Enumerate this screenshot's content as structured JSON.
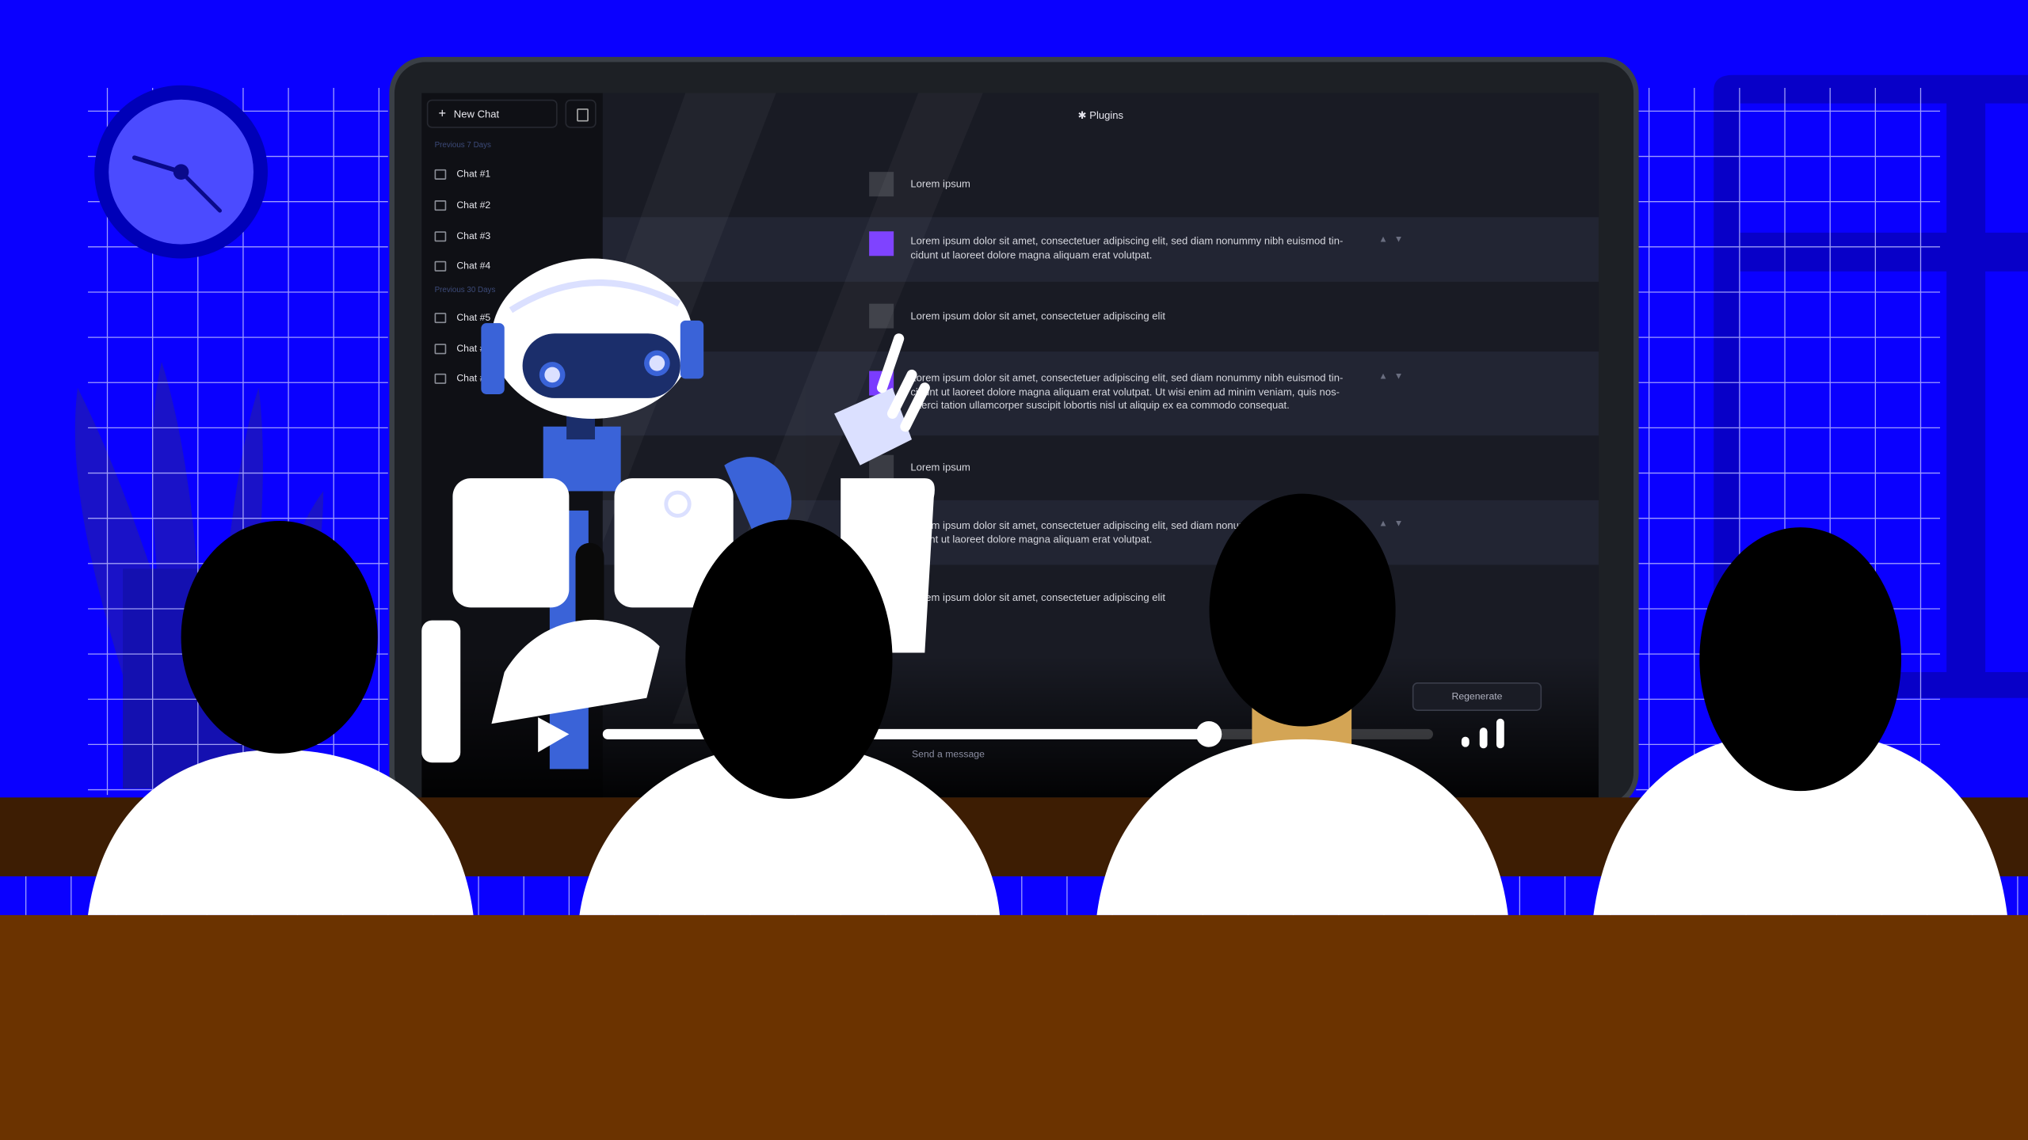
{
  "colors": {
    "background": "#0a00ff",
    "desk_top": "#3d1d03",
    "desk_front": "#6b3300",
    "screen_bg": "#191b24",
    "sidebar_bg": "#0f1015",
    "accent_avatar": "#7a3cff",
    "robot_blue": "#3a63d8",
    "skin": "#d4a555"
  },
  "sidebar": {
    "new_chat_label": "New Chat",
    "new_chat_icon": "plus-icon",
    "toggle_icon": "sidebar-toggle-icon",
    "sections": [
      {
        "title": "Previous 7 Days",
        "items": [
          "Chat #1",
          "Chat #2",
          "Chat #3",
          "Chat #4"
        ]
      },
      {
        "title": "Previous 30 Days",
        "items": [
          "Chat #5",
          "Chat #",
          "Chat #"
        ]
      }
    ]
  },
  "header": {
    "title": "Plugins",
    "icon": "puzzle-icon"
  },
  "messages": [
    {
      "role": "user",
      "text": "Lorem ipsum"
    },
    {
      "role": "assistant",
      "text": "Lorem ipsum dolor sit amet, consectetuer adipiscing elit, sed diam nonummy nibh euismod tin-cidunt ut laoreet dolore magna aliquam erat volutpat."
    },
    {
      "role": "user",
      "text": "Lorem ipsum dolor sit amet, consectetuer adipiscing elit"
    },
    {
      "role": "assistant",
      "text": "Lorem ipsum dolor sit amet, consectetuer adipiscing elit, sed diam nonummy nibh euismod tin-cidunt ut laoreet dolore magna aliquam erat volutpat. Ut wisi enim ad minim veniam, quis nos-exerci tation ullamcorper suscipit lobortis nisl ut aliquip ex ea commodo consequat."
    },
    {
      "role": "user",
      "text": "Lorem ipsum"
    },
    {
      "role": "assistant",
      "text": "Lorem ipsum dolor sit amet, consectetuer adipiscing elit, sed diam nonummy nibh euismod tin-cidunt ut laoreet dolore magna aliquam erat volutpat."
    },
    {
      "role": "user",
      "text": "Lorem ipsum dolor sit amet, consectetuer adipiscing elit"
    }
  ],
  "feedback": {
    "like_icon": "thumbs-up-icon",
    "dislike_icon": "thumbs-down-icon"
  },
  "composer": {
    "regenerate_label": "Regenerate",
    "placeholder": "Send a message"
  },
  "video": {
    "play_icon": "play-icon",
    "progress": 0.73,
    "volume_icon": "volume-bars-icon"
  }
}
